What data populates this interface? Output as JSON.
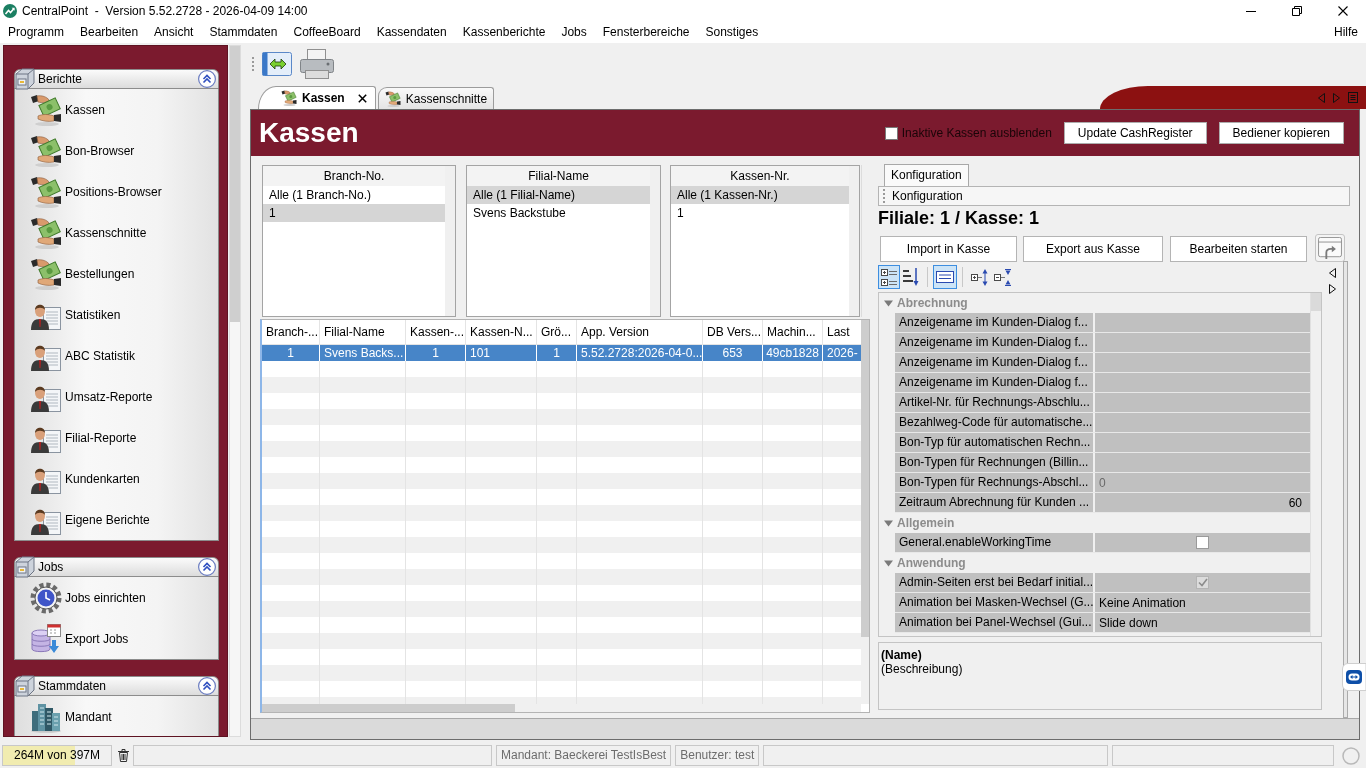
{
  "window": {
    "title": "CentralPoint  -  Version 5.52.2728 - 2026-04-09 14:00"
  },
  "menu_bar": {
    "items": [
      "Programm",
      "Bearbeiten",
      "Ansicht",
      "Stammdaten",
      "CoffeeBoard",
      "Kassendaten",
      "Kassenberichte",
      "Jobs",
      "Fensterbereiche",
      "Sonstiges"
    ],
    "help": "Hilfe"
  },
  "sidebar": {
    "groups": [
      {
        "title": "Berichte",
        "expanded": true,
        "items": [
          {
            "label": "Kassen",
            "kind": "cash"
          },
          {
            "label": "Bon-Browser",
            "kind": "cash"
          },
          {
            "label": "Positions-Browser",
            "kind": "cash"
          },
          {
            "label": "Kassenschnitte",
            "kind": "cash"
          },
          {
            "label": "Bestellungen",
            "kind": "cash"
          },
          {
            "label": "Statistiken",
            "kind": "report"
          },
          {
            "label": "ABC Statistik",
            "kind": "report"
          },
          {
            "label": "Umsatz-Reporte",
            "kind": "report"
          },
          {
            "label": "Filial-Reporte",
            "kind": "report"
          },
          {
            "label": "Kundenkarten",
            "kind": "report"
          },
          {
            "label": "Eigene Berichte",
            "kind": "report"
          }
        ]
      },
      {
        "title": "Jobs",
        "expanded": true,
        "items": [
          {
            "label": "Jobs einrichten",
            "kind": "schedule"
          },
          {
            "label": "Export Jobs",
            "kind": "export"
          }
        ]
      },
      {
        "title": "Stammdaten",
        "expanded": true,
        "items": [
          {
            "label": "Mandant",
            "kind": "company"
          }
        ]
      }
    ]
  },
  "document_tabs": [
    {
      "label": "Kassen",
      "selected": true
    },
    {
      "label": "Kassenschnitte",
      "selected": false
    }
  ],
  "panel": {
    "title": "Kassen",
    "hide_inactive": {
      "label": "Inaktive Kassen ausblenden",
      "checked": false
    },
    "buttons": [
      "Update CashRegister",
      "Bediener kopieren"
    ]
  },
  "filters": [
    {
      "header": "Branch-No.",
      "items": [
        {
          "label": "Alle (1 Branch-No.)",
          "selected": false
        },
        {
          "label": "1",
          "selected": true
        }
      ]
    },
    {
      "header": "Filial-Name",
      "items": [
        {
          "label": "Alle (1 Filial-Name)",
          "selected": true
        },
        {
          "label": "Svens Backstube",
          "selected": false
        }
      ]
    },
    {
      "header": "Kassen-Nr.",
      "items": [
        {
          "label": "Alle (1 Kassen-Nr.)",
          "selected": true
        },
        {
          "label": "1",
          "selected": false
        }
      ]
    }
  ],
  "table": {
    "columns": [
      "Branch-...",
      "Filial-Name",
      "Kassen-...",
      "Kassen-N...",
      "Grö...",
      "App. Version",
      "DB Vers...",
      "Machin...",
      "Last"
    ],
    "rows": [
      {
        "selected": true,
        "cells": [
          "1",
          "Svens Backs...",
          "1",
          "101",
          "1",
          "5.52.2728:2026-04-0...",
          "653",
          "49cb1828",
          "2026-"
        ]
      }
    ]
  },
  "config": {
    "tabs": [
      {
        "label": "Konfiguration",
        "selected": true
      }
    ],
    "section": "Konfiguration",
    "heading": "Filiale: 1 / Kasse: 1",
    "buttons": [
      "Import in Kasse",
      "Export aus Kasse",
      "Bearbeiten starten"
    ],
    "view_modes": [
      {
        "kind": "categorized",
        "selected": true
      },
      {
        "kind": "alphabetical",
        "selected": false
      }
    ],
    "description_toggle": {
      "on": true
    },
    "groups": [
      {
        "name": "Abrechnung",
        "expanded": true,
        "properties": [
          {
            "name": "Anzeigename im Kunden-Dialog f...",
            "kind": "text"
          },
          {
            "name": "Anzeigename im Kunden-Dialog f...",
            "kind": "text"
          },
          {
            "name": "Anzeigename im Kunden-Dialog f...",
            "kind": "text"
          },
          {
            "name": "Anzeigename im Kunden-Dialog f...",
            "kind": "text"
          },
          {
            "name": "Artikel-Nr. für Rechnungs-Abschlu...",
            "kind": "text"
          },
          {
            "name": "Bezahlweg-Code für automatische...",
            "kind": "text"
          },
          {
            "name": "Bon-Typ für automatischen Rechn...",
            "kind": "text"
          },
          {
            "name": "Bon-Typen für Rechnungen (Billin...",
            "kind": "text"
          },
          {
            "name": "Bon-Typen für Rechnungs-Abschl...",
            "kind": "text",
            "value": "0",
            "disabled": true
          },
          {
            "name": "Zeitraum Abrechnung für Kunden ...",
            "kind": "number",
            "value": "60",
            "disabled": false
          }
        ]
      },
      {
        "name": "Allgemein",
        "expanded": true,
        "properties": [
          {
            "name": "General.enableWorkingTime",
            "kind": "checkbox",
            "checked": false,
            "disabled": false
          }
        ]
      },
      {
        "name": "Anwendung",
        "expanded": true,
        "properties": [
          {
            "name": "Admin-Seiten erst bei Bedarf initial...",
            "kind": "checkbox",
            "checked": true,
            "disabled": true
          },
          {
            "name": "Animation bei Masken-Wechsel (G...",
            "kind": "text",
            "value": "Keine Animation",
            "disabled": false
          },
          {
            "name": "Animation bei Panel-Wechsel (Gui...",
            "kind": "text",
            "value": "Slide down",
            "disabled": false
          }
        ]
      }
    ],
    "description": {
      "name": "(Name)",
      "text": "(Beschreibung)"
    }
  },
  "status_bar": {
    "memory": {
      "text": "264M von 397M",
      "level": 0.665
    },
    "client": "Mandant: Baeckerei TestIsBest",
    "user": "Benutzer: test"
  }
}
